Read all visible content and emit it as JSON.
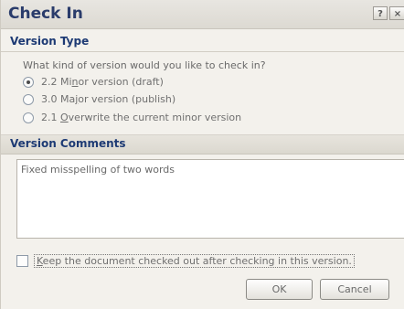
{
  "window": {
    "title": "Check In",
    "help_glyph": "?",
    "close_glyph": "×"
  },
  "version_type": {
    "heading": "Version Type",
    "question": "What kind of version would you like to check in?",
    "options": [
      {
        "prefix": "2.2 Mi",
        "mnemonic": "n",
        "suffix": "or version (draft)",
        "selected": true
      },
      {
        "prefix": "3.0 Ma",
        "mnemonic": "j",
        "suffix": "or version (publish)",
        "selected": false
      },
      {
        "prefix": "2.1 ",
        "mnemonic": "O",
        "suffix": "verwrite the current minor version",
        "selected": false
      }
    ]
  },
  "version_comments": {
    "heading": "Version Comments",
    "value": "Fixed misspelling of two words"
  },
  "keep_checked_out": {
    "mnemonic": "K",
    "label_rest": "eep the document checked out after checking in this version.",
    "checked": false
  },
  "buttons": {
    "ok": "OK",
    "cancel": "Cancel"
  }
}
